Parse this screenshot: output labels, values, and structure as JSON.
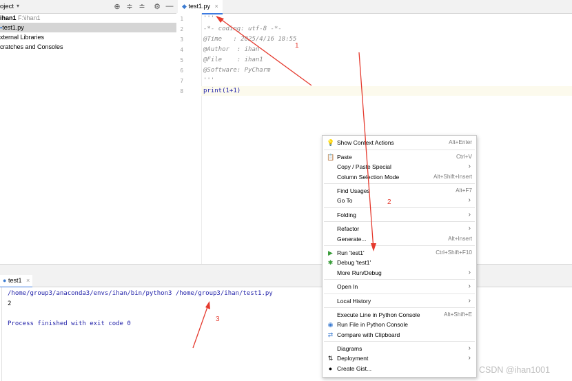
{
  "project": {
    "title": "oject",
    "root_name": "ihan1",
    "root_path": "F:\\ihan1",
    "file": "test1.py",
    "external": "xternal Libraries",
    "scratches": "cratches and Consoles"
  },
  "editor": {
    "tab": "test1.py",
    "line_numbers": [
      "1",
      "2",
      "3",
      "4",
      "5",
      "6",
      "7",
      "8"
    ],
    "lines": [
      "'''",
      "-*- coding: utf-8 -*-",
      "@Time   : 2025/4/16 18:55",
      "@Author  : ihan",
      "@File    : ihan1",
      "@Software: PyCharm",
      "'''",
      "print(1+1)"
    ]
  },
  "run": {
    "tab": "test1",
    "command": "/home/group3/anaconda3/envs/ihan/bin/python3 /home/group3/ihan/test1.py",
    "output": "2",
    "exit": "Process finished with exit code 0"
  },
  "menu": {
    "items": [
      {
        "label": "Show Context Actions",
        "shortcut": "Alt+Enter",
        "icon": "bulb-icon"
      },
      {
        "label": "Paste",
        "shortcut": "Ctrl+V",
        "icon": "clipboard-icon"
      },
      {
        "label": "Copy / Paste Special",
        "arrow": true
      },
      {
        "label": "Column Selection Mode",
        "shortcut": "Alt+Shift+Insert"
      },
      {
        "label": "Find Usages",
        "shortcut": "Alt+F7"
      },
      {
        "label": "Go To",
        "arrow": true
      },
      {
        "label": "Folding",
        "arrow": true
      },
      {
        "label": "Refactor",
        "arrow": true
      },
      {
        "label": "Generate...",
        "shortcut": "Alt+Insert"
      },
      {
        "label": "Run 'test1'",
        "shortcut": "Ctrl+Shift+F10",
        "icon": "run-icon"
      },
      {
        "label": "Debug 'test1'",
        "icon": "debug-icon"
      },
      {
        "label": "More Run/Debug",
        "arrow": true
      },
      {
        "label": "Open In",
        "arrow": true
      },
      {
        "label": "Local History",
        "arrow": true
      },
      {
        "label": "Execute Line in Python Console",
        "shortcut": "Alt+Shift+E"
      },
      {
        "label": "Run File in Python Console",
        "icon": "python-icon"
      },
      {
        "label": "Compare with Clipboard",
        "icon": "compare-icon"
      },
      {
        "label": "Diagrams",
        "arrow": true
      },
      {
        "label": "Deployment",
        "arrow": true,
        "icon": "deploy-icon"
      },
      {
        "label": "Create Gist...",
        "icon": "github-icon"
      }
    ]
  },
  "annotations": {
    "a1": "1",
    "a2": "2",
    "a3": "3"
  },
  "watermark": "CSDN @ihan1001",
  "colors": {
    "accent": "#3d7ae0",
    "annotation": "#e53a2e",
    "run_green": "#3a9c3a"
  }
}
